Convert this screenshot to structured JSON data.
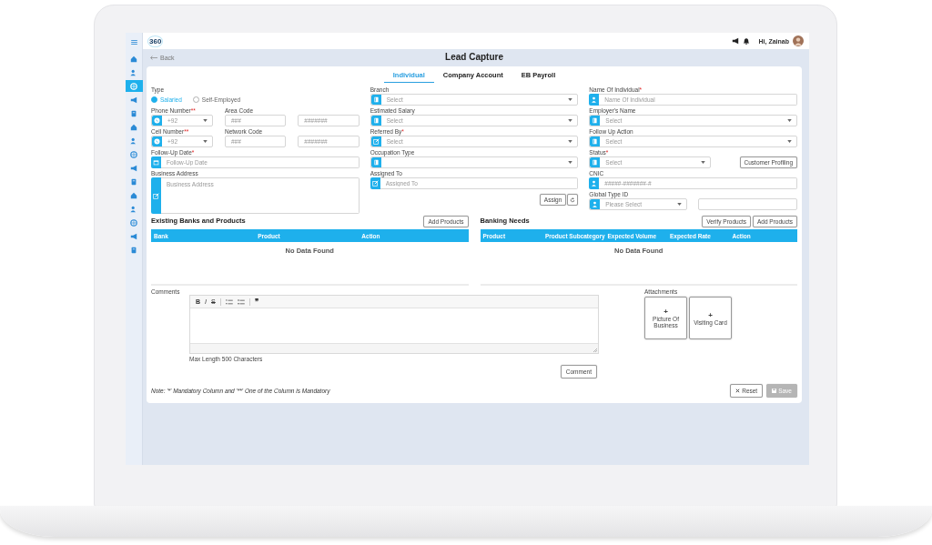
{
  "header": {
    "logo": "360",
    "greeting": "Hi, Zainab"
  },
  "sidebar": {
    "items": [
      {
        "selected": false
      },
      {
        "selected": false
      },
      {
        "selected": true
      },
      {
        "selected": false
      },
      {
        "selected": false
      },
      {
        "selected": false
      },
      {
        "selected": false
      },
      {
        "selected": false
      },
      {
        "selected": false
      },
      {
        "selected": false
      },
      {
        "selected": false
      },
      {
        "selected": false
      },
      {
        "selected": false
      },
      {
        "selected": false
      },
      {
        "selected": false
      }
    ]
  },
  "back_link": "Back",
  "title": "Lead Capture",
  "tabs": [
    {
      "label": "Individual",
      "selected": true
    },
    {
      "label": "Company Account",
      "selected": false
    },
    {
      "label": "EB Payroll",
      "selected": false
    }
  ],
  "type": {
    "label": "Type",
    "options": [
      {
        "label": "Salaried",
        "selected": true
      },
      {
        "label": "Self-Employed",
        "selected": false
      }
    ]
  },
  "phone_rows": [
    {
      "label": "Phone Number",
      "required_mark": "**",
      "prefix": "+92",
      "code_label": "Area Code",
      "code_placeholder": "###",
      "number_placeholder": "#######"
    },
    {
      "label": "Cell Number",
      "required_mark": "**",
      "prefix": "+92",
      "code_label": "Network Code",
      "code_placeholder": "###",
      "number_placeholder": "#######"
    }
  ],
  "left_fields": [
    {
      "kind": "input",
      "label": "Follow-Up Date",
      "required_mark": "*",
      "placeholder": "Follow-Up Date"
    },
    {
      "kind": "textarea",
      "label": "Business Address",
      "placeholder": "Business Address"
    }
  ],
  "middle_fields": [
    {
      "kind": "select",
      "label": "Branch",
      "placeholder": "Select"
    },
    {
      "kind": "select",
      "label": "Estimated Salary",
      "placeholder": "Select"
    },
    {
      "kind": "select",
      "label": "Referred By",
      "required_mark": "*",
      "placeholder": "Select"
    },
    {
      "kind": "select",
      "label": "Occupation Type"
    },
    {
      "kind": "input",
      "label": "Assigned To",
      "placeholder": "Assigned To"
    }
  ],
  "assign_button": "Assign",
  "right_fields": [
    {
      "kind": "input",
      "label": "Name Of Individual",
      "required_mark": "*",
      "placeholder": "Name Of Individual"
    },
    {
      "kind": "select",
      "label": "Employer's Name",
      "placeholder": "Select"
    },
    {
      "kind": "select",
      "label": "Follow Up Action",
      "placeholder": "Select"
    },
    {
      "kind": "select_button",
      "label": "Status",
      "required_mark": "*",
      "placeholder": "Select",
      "button": "Customer Profiling"
    },
    {
      "kind": "input",
      "label": "CNIC",
      "placeholder": "#####-#######-#"
    },
    {
      "kind": "select_input",
      "label": "Global Type ID",
      "placeholder": "Please Select"
    }
  ],
  "tables": [
    {
      "title": "Existing Banks and Products",
      "buttons": [
        "Add Products"
      ],
      "columns": [
        "Bank",
        "Product",
        "Action"
      ],
      "empty_text": "No Data Found"
    },
    {
      "title": "Banking Needs",
      "buttons": [
        "Verify Products",
        "Add Products"
      ],
      "columns": [
        "Product",
        "Product Subcategory",
        "Expected Volume",
        "Expected Rate",
        "Action"
      ],
      "empty_text": "No Data Found"
    }
  ],
  "comments": {
    "label": "Comments",
    "toolbar": [
      {
        "kind": "bold",
        "text": "B"
      },
      {
        "kind": "italic",
        "text": "I"
      },
      {
        "kind": "strike",
        "text": "S"
      },
      {
        "kind": "ordered-list"
      },
      {
        "kind": "bullet-list"
      },
      {
        "kind": "quote",
        "text": "❞"
      }
    ],
    "hint": "Max Length 500 Characters",
    "button": "Comment"
  },
  "attachments": {
    "label": "Attachments",
    "items": [
      {
        "plus": "+",
        "label": "Picture Of Business"
      },
      {
        "plus": "+",
        "label": "Visiting Card"
      }
    ]
  },
  "note": "Note: '*' Mandatory Column and '**' One of the Column is Mandatory",
  "actions": [
    {
      "kind": "reset",
      "label": "Reset",
      "disabled": false
    },
    {
      "kind": "save",
      "label": "Save",
      "disabled": true
    }
  ]
}
